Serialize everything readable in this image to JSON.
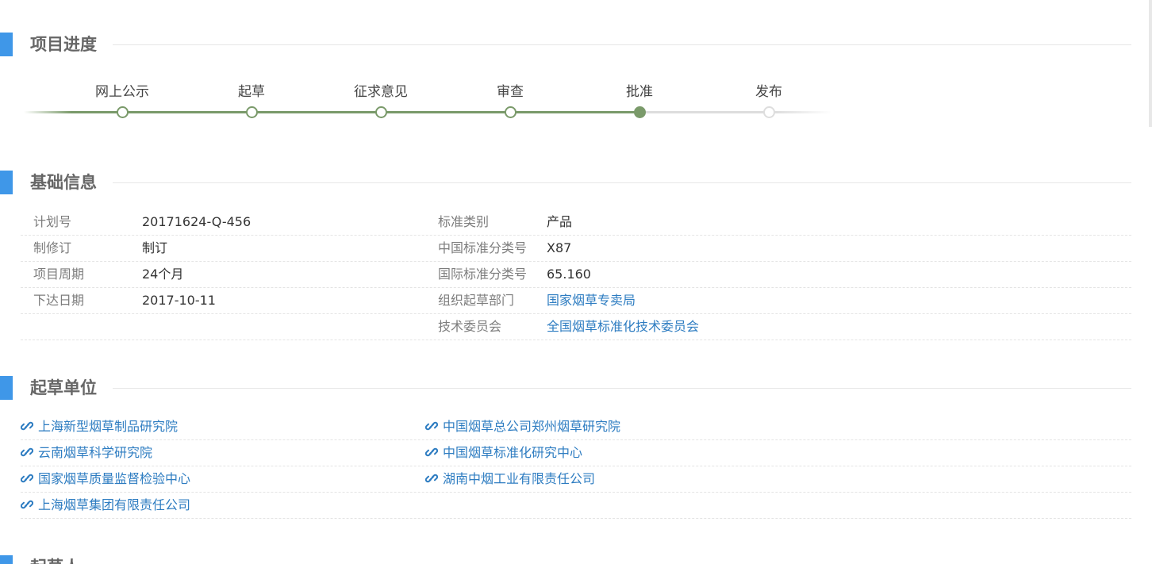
{
  "colors": {
    "accent_bar": "#3f97e8",
    "progress_done": "#7a9a6a",
    "progress_todo": "#dddddd",
    "link": "#2d7cc1"
  },
  "progress_section": {
    "title": "项目进度",
    "steps": [
      {
        "label": "网上公示",
        "state": "done"
      },
      {
        "label": "起草",
        "state": "done"
      },
      {
        "label": "征求意见",
        "state": "done"
      },
      {
        "label": "审查",
        "state": "done"
      },
      {
        "label": "批准",
        "state": "current"
      },
      {
        "label": "发布",
        "state": "todo"
      }
    ]
  },
  "basic_info": {
    "title": "基础信息",
    "rows": [
      {
        "left_label": "计划号",
        "left_value": "20171624-Q-456",
        "right_label": "标准类别",
        "right_value": "产品"
      },
      {
        "left_label": "制修订",
        "left_value": "制订",
        "right_label": "中国标准分类号",
        "right_value": "X87"
      },
      {
        "left_label": "项目周期",
        "left_value": "24个月",
        "right_label": "国际标准分类号",
        "right_value": "65.160"
      },
      {
        "left_label": "下达日期",
        "left_value": "2017-10-11",
        "right_label": "组织起草部门",
        "right_value": "国家烟草专卖局"
      },
      {
        "left_label": "",
        "left_value": "",
        "right_label": "技术委员会",
        "right_value": "全国烟草标准化技术委员会"
      }
    ]
  },
  "drafting_units": {
    "title": "起草单位",
    "icon": "link-icon",
    "rows": [
      [
        "上海新型烟草制品研究院",
        "中国烟草总公司郑州烟草研究院"
      ],
      [
        "云南烟草科学研究院",
        "中国烟草标准化研究中心"
      ],
      [
        "国家烟草质量监督检验中心",
        "湖南中烟工业有限责任公司"
      ],
      [
        "上海烟草集团有限责任公司",
        ""
      ]
    ]
  },
  "next_section": {
    "title": "起草人"
  }
}
